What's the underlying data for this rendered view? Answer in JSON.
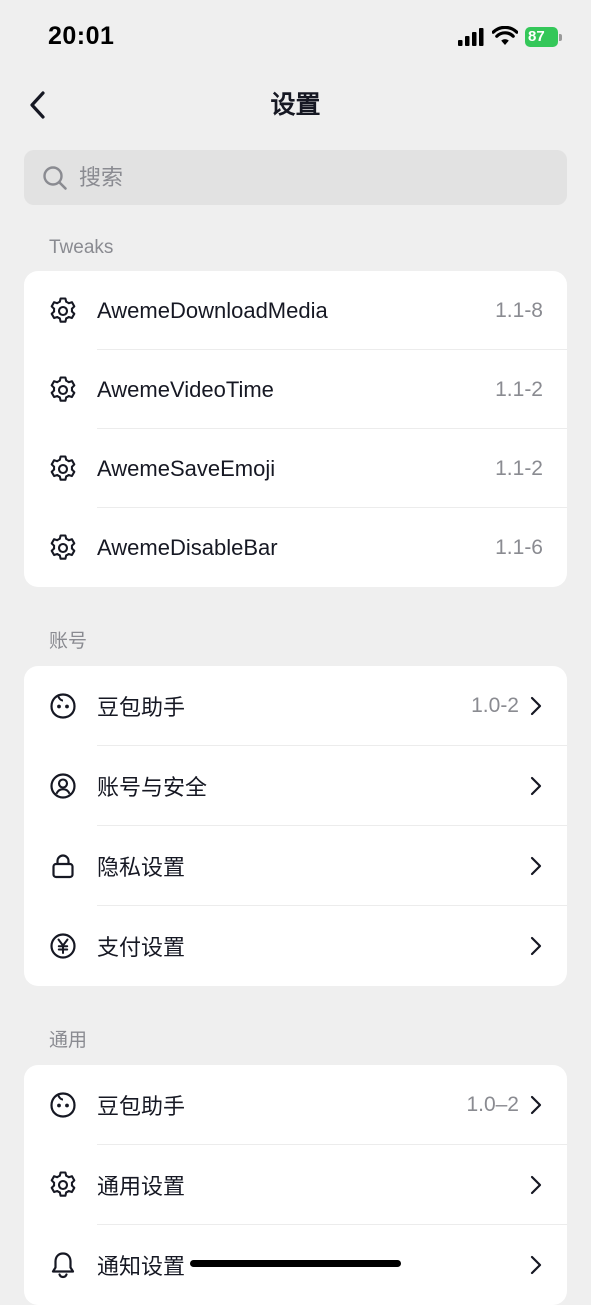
{
  "status_bar": {
    "time": "20:01",
    "battery": "87",
    "battery_color": "#34c759"
  },
  "nav": {
    "title": "设置",
    "back_icon": "chevron-left-icon"
  },
  "search": {
    "placeholder": "搜索"
  },
  "sections": {
    "tweaks": {
      "header": "Tweaks",
      "items": [
        {
          "label": "AwemeDownloadMedia",
          "value": "1.1-8",
          "icon": "gear-icon"
        },
        {
          "label": "AwemeVideoTime",
          "value": "1.1-2",
          "icon": "gear-icon"
        },
        {
          "label": "AwemeSaveEmoji",
          "value": "1.1-2",
          "icon": "gear-icon"
        },
        {
          "label": "AwemeDisableBar",
          "value": "1.1-6",
          "icon": "gear-icon"
        }
      ]
    },
    "account": {
      "header": "账号",
      "items": [
        {
          "label": "豆包助手",
          "value": "1.0-2",
          "icon": "bot-face-icon"
        },
        {
          "label": "账号与安全",
          "value": "",
          "icon": "user-circle-icon"
        },
        {
          "label": "隐私设置",
          "value": "",
          "icon": "lock-icon"
        },
        {
          "label": "支付设置",
          "value": "",
          "icon": "yen-circle-icon"
        }
      ]
    },
    "general": {
      "header": "通用",
      "items": [
        {
          "label": "豆包助手",
          "value": "1.0–2",
          "icon": "bot-face-icon"
        },
        {
          "label": "通用设置",
          "value": "",
          "icon": "gear-icon"
        },
        {
          "label": "通知设置",
          "value": "",
          "icon": "bell-icon"
        }
      ]
    }
  }
}
